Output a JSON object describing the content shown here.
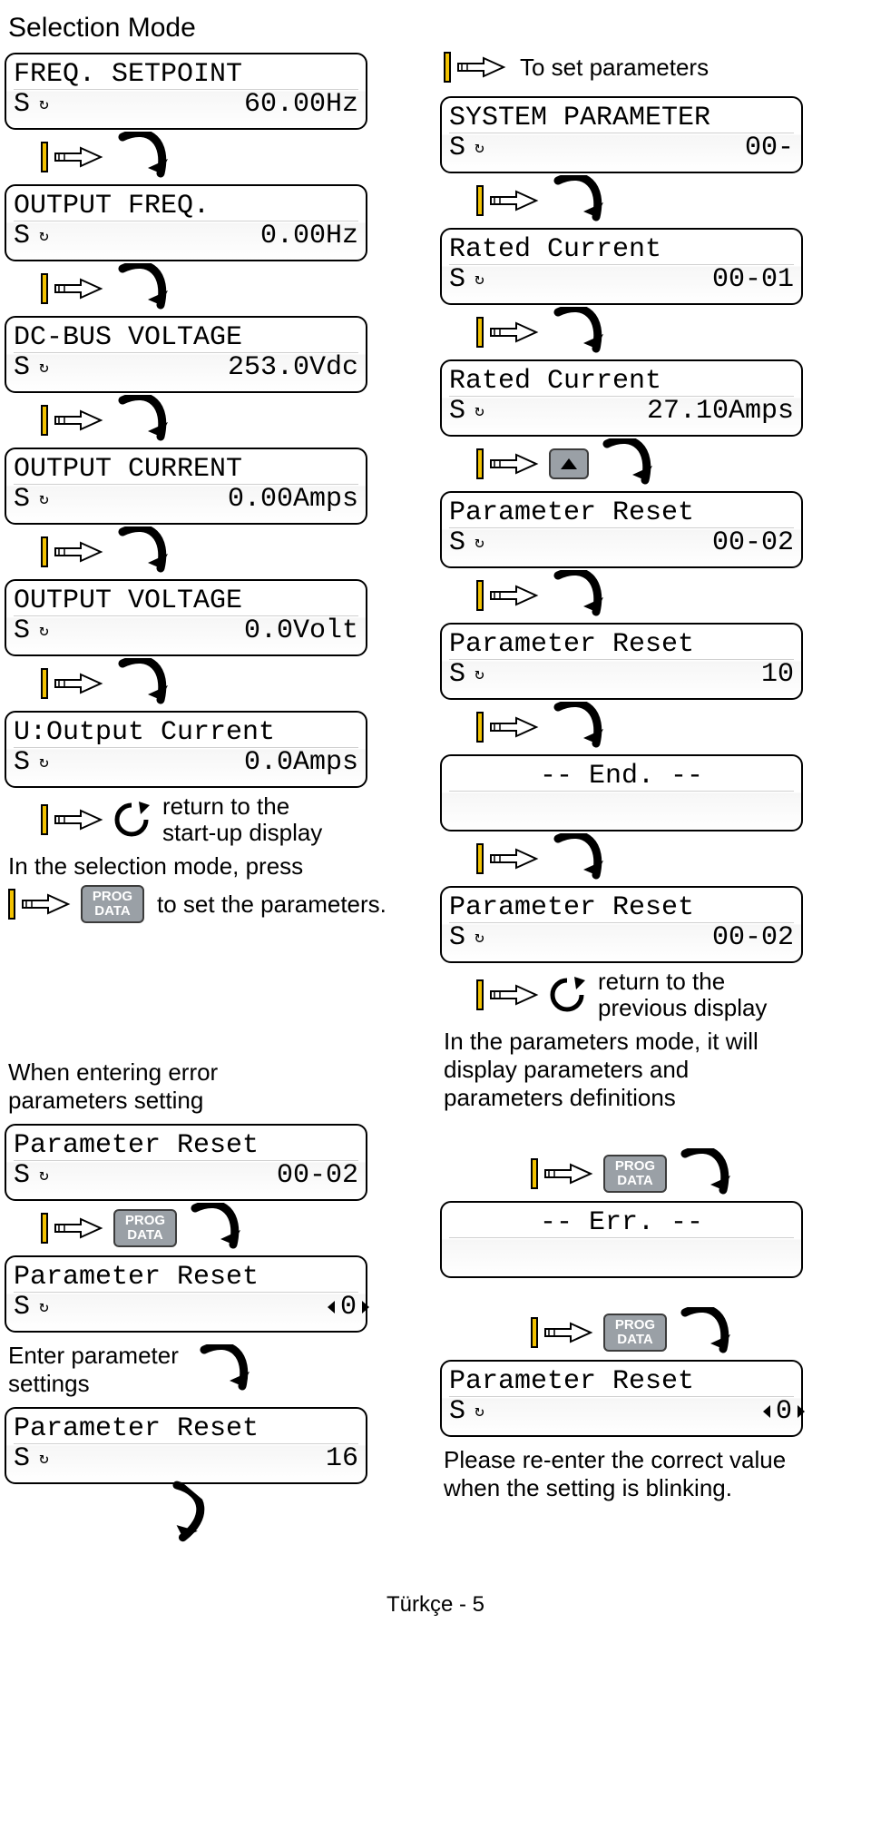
{
  "title": "Selection Mode",
  "left": {
    "screens": [
      {
        "line1": "FREQ. SETPOINT",
        "line2_r": "60.00Hz"
      },
      {
        "line1": "OUTPUT FREQ.",
        "line2_r": "0.00Hz"
      },
      {
        "line1": "DC-BUS VOLTAGE",
        "line2_r": "253.0Vdc"
      },
      {
        "line1": "OUTPUT CURRENT",
        "line2_r": "0.00Amps"
      },
      {
        "line1": "OUTPUT VOLTAGE",
        "line2_r": "0.0Volt"
      },
      {
        "line1": "U:Output Current",
        "line2_r": "0.0Amps"
      }
    ],
    "return_note": "return to the\nstart-up display",
    "sel_note_a": "In the selection mode, press",
    "sel_note_b": "to set the parameters.",
    "err_heading": "When entering error\nparameters setting",
    "err_screens": {
      "a": {
        "line1": "Parameter Reset",
        "line2_r": "00-02"
      },
      "b": {
        "line1": "Parameter Reset",
        "line2_r": "0",
        "blinking": true
      },
      "c_note": "Enter parameter\nsettings",
      "c": {
        "line1": "Parameter Reset",
        "line2_r": "16"
      }
    }
  },
  "right": {
    "top_note": "To set parameters",
    "screens": [
      {
        "line1": "SYSTEM PARAMETER",
        "line2_r": "00-"
      },
      {
        "line1": "Rated Current",
        "line2_r": "00-01"
      },
      {
        "line1": "Rated Current",
        "line2_r": "27.10Amps"
      },
      {
        "line1": "Parameter Reset",
        "line2_r": "00-02"
      },
      {
        "line1": "Parameter Reset",
        "line2_r": "10"
      },
      {
        "center": "-- End. --"
      },
      {
        "line1": "Parameter Reset",
        "line2_r": "00-02"
      }
    ],
    "return_note": "return to the\nprevious display",
    "param_note": "In the parameters mode, it will\ndisplay parameters and\nparameters definitions",
    "err_center": "-- Err. --",
    "last": {
      "line1": "Parameter Reset",
      "line2_r": "0",
      "blinking": true
    },
    "last_note": "Please re-enter the correct value\nwhen the setting is blinking."
  },
  "buttons": {
    "prog_top": "PROG",
    "prog_bot": "DATA"
  },
  "footer": "Türkçe - 5"
}
